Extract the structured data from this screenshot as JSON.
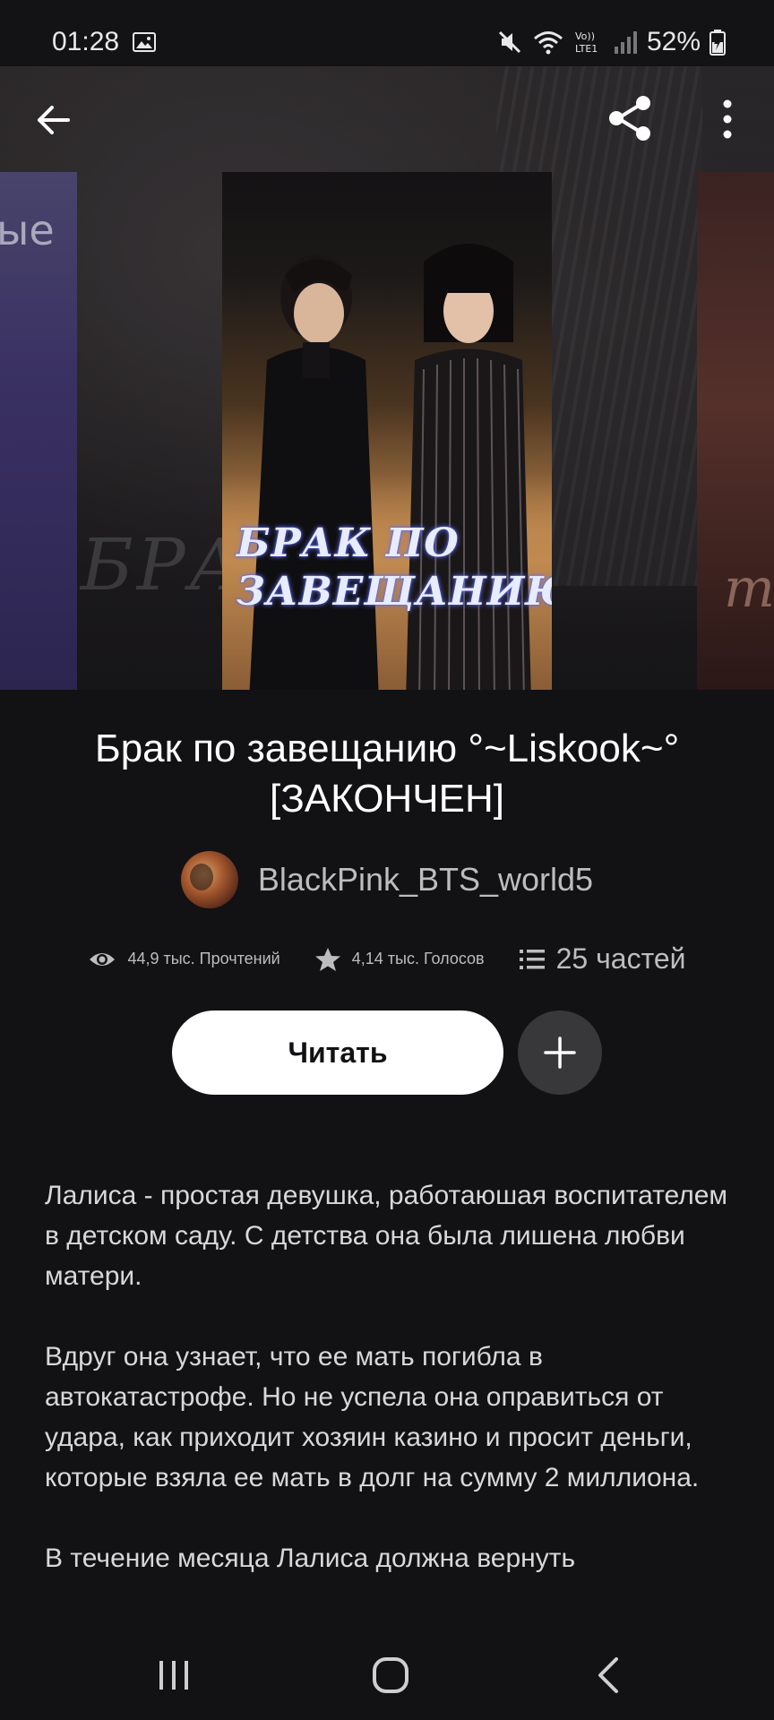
{
  "status_bar": {
    "time": "01:28",
    "battery": "52%",
    "icons": [
      "gallery-icon",
      "mute-icon",
      "wifi-icon",
      "volte-icon",
      "signal-icon",
      "battery-charging-icon"
    ],
    "volte_label": "Vo)) LTE1"
  },
  "header": {
    "icons": [
      "back-arrow-icon",
      "share-icon",
      "more-vert-icon"
    ]
  },
  "covers": {
    "main_cover_title_line1": "БРАК ПО",
    "main_cover_title_line2": "ЗАВЕЩАНИЮ",
    "left_side_text": "ые",
    "background_text": "БРА",
    "right_side_text": "те"
  },
  "story": {
    "title": "Брак по завещанию  °~Liskook~° [ЗАКОНЧЕН]",
    "author": "BlackPink_BTS_world5"
  },
  "stats": {
    "reads": "44,9 тыс. Прочтений",
    "votes": "4,14 тыс. Голосов",
    "parts": "25 частей"
  },
  "actions": {
    "read_label": "Читать",
    "add_icon": "plus-icon"
  },
  "description": {
    "paragraphs": [
      "Лалиса - простая девушка, работаюшая воспитателем в детском саду. С детства она была лишена любви матери.",
      "Вдруг она узнает, что ее мать погибла в автокатастрофе. Но не успела она оправиться от удара, как приходит хозяин казино и просит деньги, которые взяла ее мать в долг на сумму 2 миллиона.",
      "В течение месяца Лалиса должна вернуть"
    ]
  },
  "nav_bar": {
    "icons": [
      "recents-icon",
      "home-icon",
      "nav-back-icon"
    ]
  },
  "colors": {
    "background": "#121114",
    "button_primary": "#ffffff",
    "button_secondary": "#38373a",
    "text_primary": "#ffffff",
    "text_secondary": "#bdbdbd"
  }
}
